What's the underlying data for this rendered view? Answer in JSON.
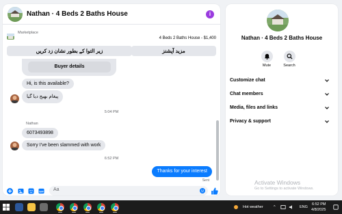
{
  "chat": {
    "title": "Nathan · 4 Beds 2 Baths House",
    "marketplace_label": "Marketplace",
    "listing": "4 Beds 2 Baths House - $1,400",
    "action_left": "زیر التوا کے بطور نشان زد کریں",
    "action_right": "مزید آپشنز",
    "buyer_details": "Buyer details",
    "messages": [
      "Hi, is this available?",
      "پیغام بھیج دیا گیا",
      "6073493898",
      "Sorry I've been slammed with work"
    ],
    "time_1": "5:04 PM",
    "sender": "Nathan",
    "time_2": "6:52 PM",
    "outgoing": "Thanks for your interest",
    "sent_status": "Sent",
    "composer_placeholder": "Aa"
  },
  "info": {
    "title": "Nathan · 4 Beds 2 Baths House",
    "mute_label": "Mute",
    "search_label": "Search",
    "rows": [
      "Customize chat",
      "Chat members",
      "Media, files and links",
      "Privacy & support"
    ],
    "watermark_title": "Activate Windows",
    "watermark_sub": "Go to Settings to activate Windows."
  },
  "taskbar": {
    "weather": "Hot weather",
    "lang": "ENG",
    "time": "6:52 PM",
    "date": "4/8/2025"
  },
  "colors": {
    "accent": "#0a7cff",
    "info_icon": "#9a3bdf",
    "bubble_in": "#e4e6eb"
  }
}
